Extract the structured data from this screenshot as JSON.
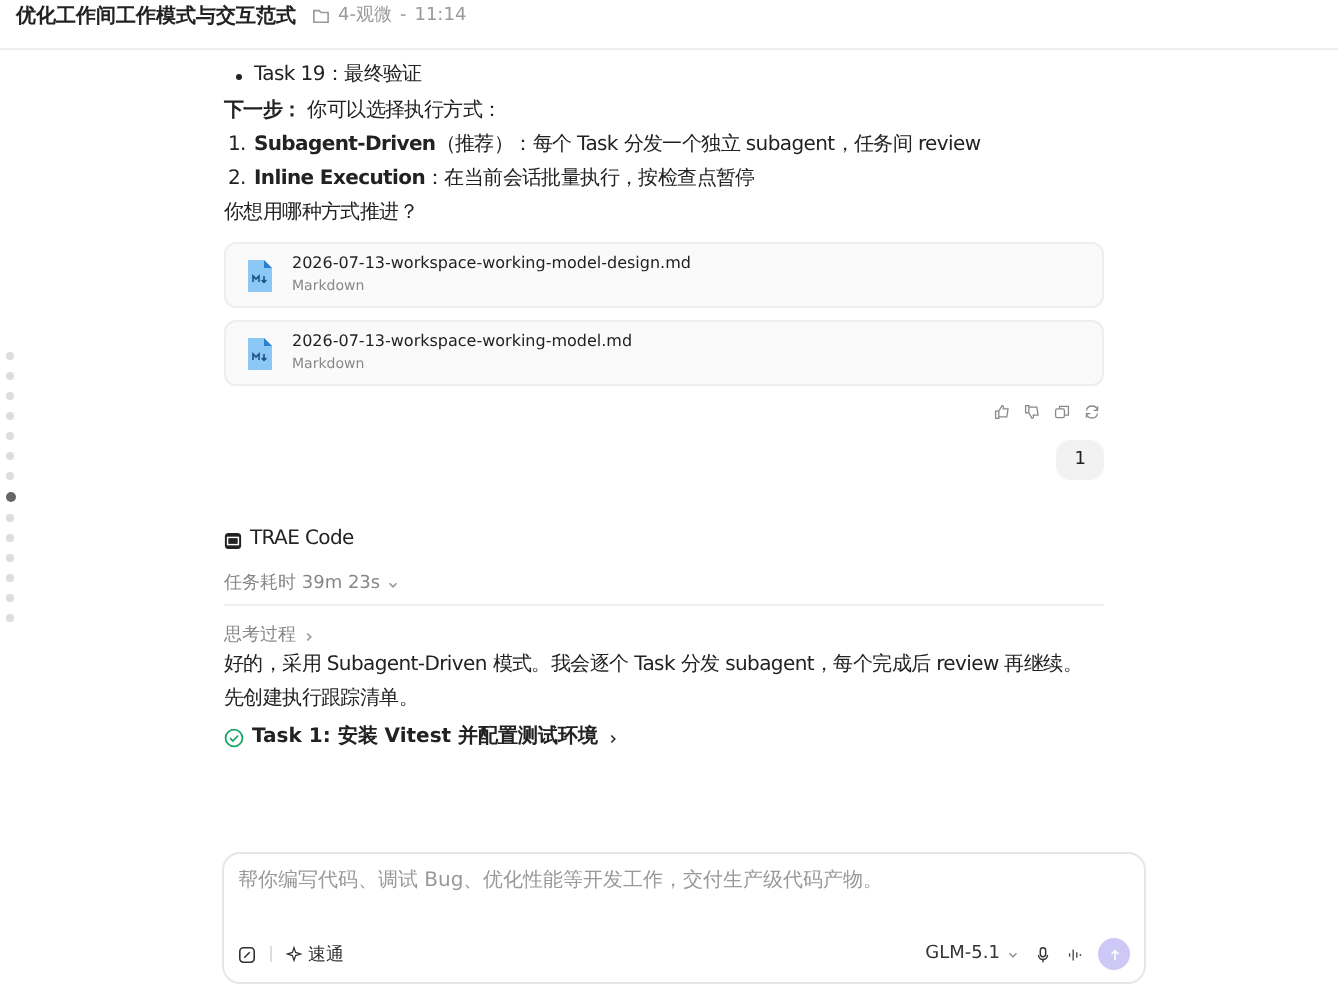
{
  "header": {
    "title": "优化工作间工作模式与交互范式",
    "folder": "4-观微",
    "separator": "-",
    "time": "11:14"
  },
  "nav_markers": [
    {
      "selected": false
    },
    {
      "selected": false
    },
    {
      "selected": false
    },
    {
      "selected": false
    },
    {
      "selected": false
    },
    {
      "selected": false
    },
    {
      "selected": false
    },
    {
      "selected": true
    },
    {
      "selected": false
    },
    {
      "selected": false
    },
    {
      "selected": false
    },
    {
      "selected": false
    },
    {
      "selected": false
    },
    {
      "selected": false
    }
  ],
  "reply": {
    "bullets": [
      "Task 19：最终验证"
    ],
    "next_step": "**下一步：** 你可以选择执行方式：",
    "options": [
      {
        "number": "1.",
        "text": "**Subagent-Driven**（推荐）：每个 Task 分发一个独立 subagent，任务间 review"
      },
      {
        "number": "2.",
        "text": "**Inline Execution**：在当前会话批量执行，按检查点暂停"
      }
    ],
    "question": "你想用哪种方式推进？",
    "files": [
      {
        "name": "2026-07-13-workspace-working-model-design.md",
        "type": "Markdown"
      },
      {
        "name": "2026-07-13-workspace-working-model.md",
        "type": "Markdown"
      }
    ]
  },
  "user_message": "1",
  "agent": {
    "name": "TRAE Code",
    "duration": "任务耗时 39m 23s",
    "thinking": "思考过程",
    "paragraphs": [
      "好的，采用 Subagent-Driven 模式。我会逐个 Task 分发 subagent，每个完成后 review 再继续。",
      "先创建执行跟踪清单。"
    ],
    "tasks": [
      {
        "label": "Task 1: 安装 Vitest 并配置测试环境",
        "done": true
      }
    ]
  },
  "composer": {
    "placeholder": "帮你编写代码、调试 Bug、优化性能等开发工作，交付生产级代码产物。",
    "mode": "速通",
    "model": "GLM-5.1"
  }
}
